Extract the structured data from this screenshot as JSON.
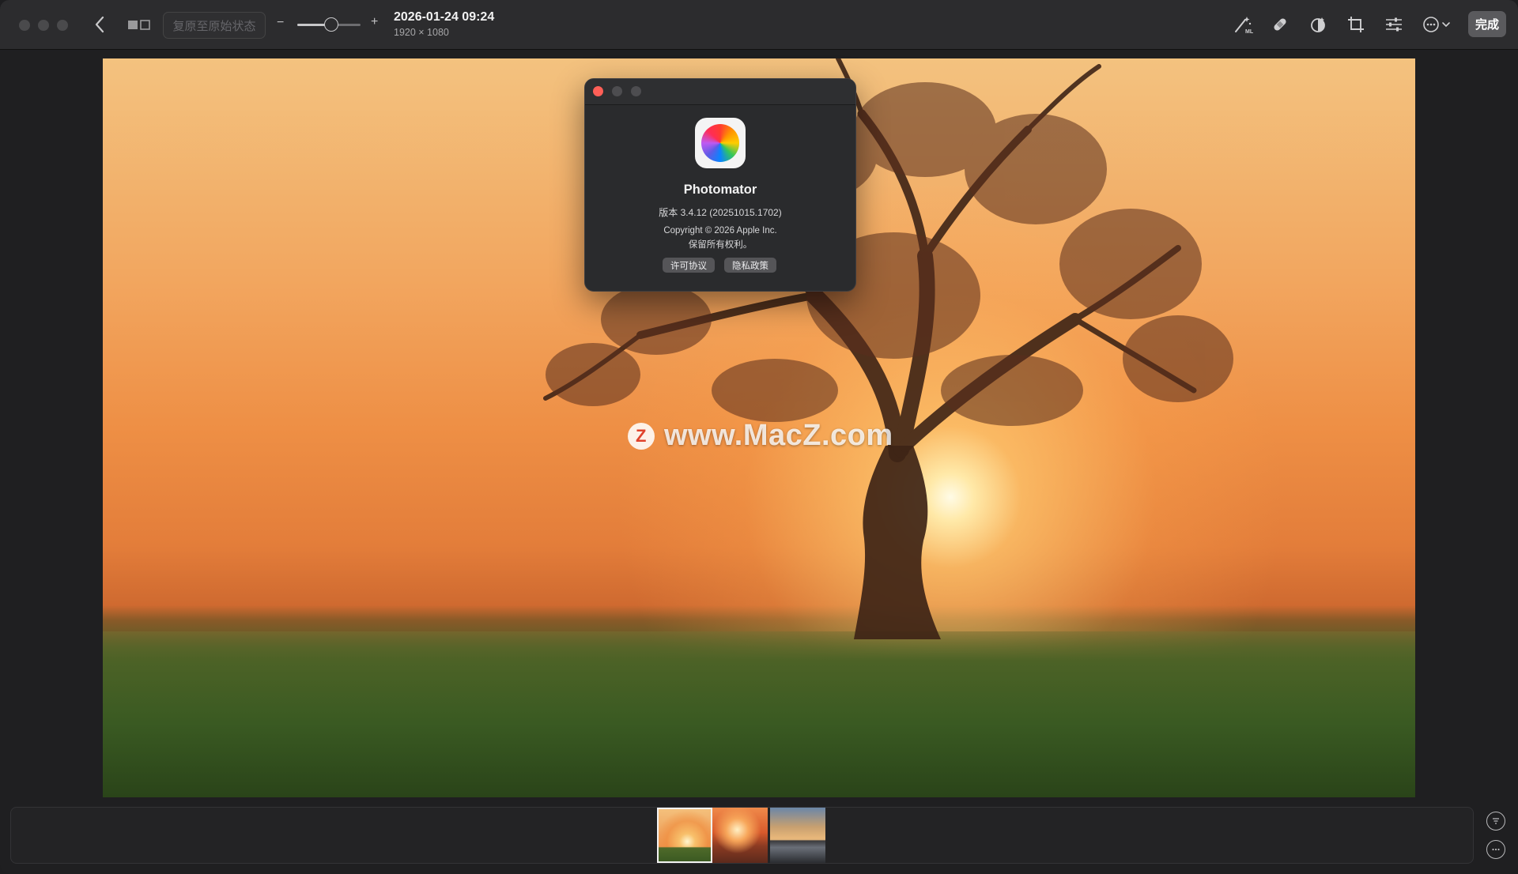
{
  "toolbar": {
    "revert_label": "复原至原始状态",
    "zoom_minus": "−",
    "zoom_plus": "+",
    "zoom_level": 0.45,
    "title": "2026-01-24 09:24",
    "dimensions": "1920 × 1080",
    "done_label": "完成",
    "tools": [
      "ml-enhance-icon",
      "retouch-bandage-icon",
      "select-mask-icon",
      "crop-icon",
      "adjust-sliders-icon",
      "more-menu-icon"
    ]
  },
  "about": {
    "app_name": "Photomator",
    "version": "版本 3.4.12 (20251015.1702)",
    "copyright": "Copyright © 2026 Apple Inc.",
    "rights": "保留所有权利。",
    "license_button": "许可协议",
    "privacy_button": "隐私政策"
  },
  "watermark": {
    "badge": "Z",
    "text": "www.MacZ.com"
  },
  "filmstrip": {
    "thumbnails": [
      "tree-sunrise",
      "sunset-cliff",
      "pier-sunset"
    ],
    "selected_index": 0
  },
  "colors": {
    "toolbar_bg": "#2c2c2e",
    "window_bg": "#1f1f21",
    "close_red": "#ff5f57",
    "done_button": "#5a5a5d"
  }
}
